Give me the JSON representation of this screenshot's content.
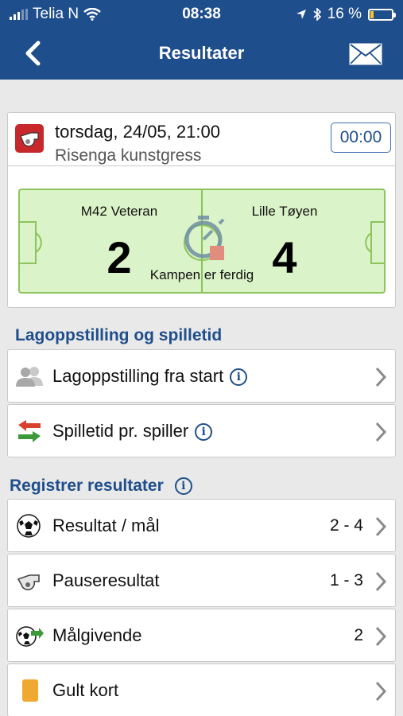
{
  "status_bar": {
    "carrier": "Telia N",
    "time": "08:38",
    "battery": "16 %",
    "battery_level": 0.16
  },
  "nav": {
    "title": "Resultater",
    "back_icon": "chevron-left-icon",
    "mail_icon": "envelope-icon"
  },
  "match": {
    "date": "torsdag, 24/05, 21:00",
    "venue": "Risenga kunstgress",
    "timer": "00:00",
    "home_team": "M42 Veteran",
    "away_team": "Lille Tøyen",
    "home_score": "2",
    "away_score": "4",
    "status": "Kampen er ferdig"
  },
  "lineup_section": {
    "title": "Lagoppstilling og spilletid",
    "items": [
      {
        "label": "Lagoppstilling fra start",
        "icon": "people-icon",
        "has_info": true
      },
      {
        "label": "Spilletid pr. spiller",
        "icon": "substitution-arrows-icon",
        "has_info": true
      }
    ]
  },
  "results_section": {
    "title": "Registrer resultater",
    "items": [
      {
        "label": "Resultat / mål",
        "value": "2 - 4",
        "icon": "soccer-ball-icon"
      },
      {
        "label": "Pauseresultat",
        "value": "1 - 3",
        "icon": "whistle-icon"
      },
      {
        "label": "Målgivende",
        "value": "2",
        "icon": "ball-assist-icon"
      },
      {
        "label": "Gult kort",
        "value": "",
        "icon": "yellow-card-icon"
      }
    ]
  },
  "colors": {
    "primary": "#1f4e8c",
    "pitch": "#dbf3c8",
    "pitch_line": "#8cc45a",
    "yellow_card": "#f0a830",
    "whistle_badge": "#c8282b"
  }
}
